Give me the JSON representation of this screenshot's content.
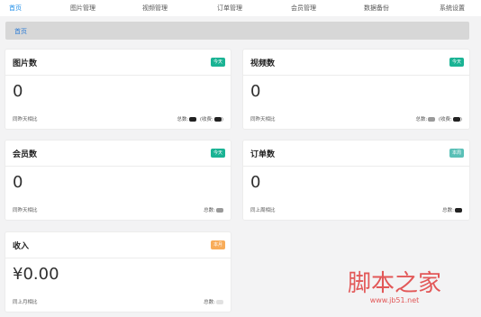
{
  "nav": {
    "items": [
      {
        "label": "首页",
        "active": true
      },
      {
        "label": "图片管理",
        "active": false
      },
      {
        "label": "视频管理",
        "active": false
      },
      {
        "label": "订单管理",
        "active": false
      },
      {
        "label": "会员管理",
        "active": false
      },
      {
        "label": "数据备份",
        "active": false
      },
      {
        "label": "系统设置",
        "active": false
      }
    ]
  },
  "breadcrumb": {
    "home": "首页"
  },
  "cards": {
    "images": {
      "title": "图片数",
      "badge": "今天",
      "badge_color": "#1ab394",
      "value": "0",
      "compare": "同昨天相比",
      "total_label": "总数:",
      "charge_label": "(收费:"
    },
    "videos": {
      "title": "视频数",
      "badge": "今天",
      "badge_color": "#1ab394",
      "value": "0",
      "compare": "同昨天相比",
      "total_label": "总数:",
      "charge_label": "(收费:"
    },
    "members": {
      "title": "会员数",
      "badge": "今天",
      "badge_color": "#1ab394",
      "value": "0",
      "compare": "同昨天相比",
      "total_label": "总数:"
    },
    "orders": {
      "title": "订单数",
      "badge": "本周",
      "badge_color": "#5ac0b7",
      "value": "0",
      "compare": "同上周相比",
      "total_label": "总数:"
    },
    "income": {
      "title": "收入",
      "badge": "本月",
      "badge_color": "#f8ac59",
      "value": "¥0.00",
      "compare": "同上月相比",
      "total_label": "总数:"
    }
  },
  "watermark": {
    "title": "脚本之家",
    "url": "www.jb51.net"
  }
}
